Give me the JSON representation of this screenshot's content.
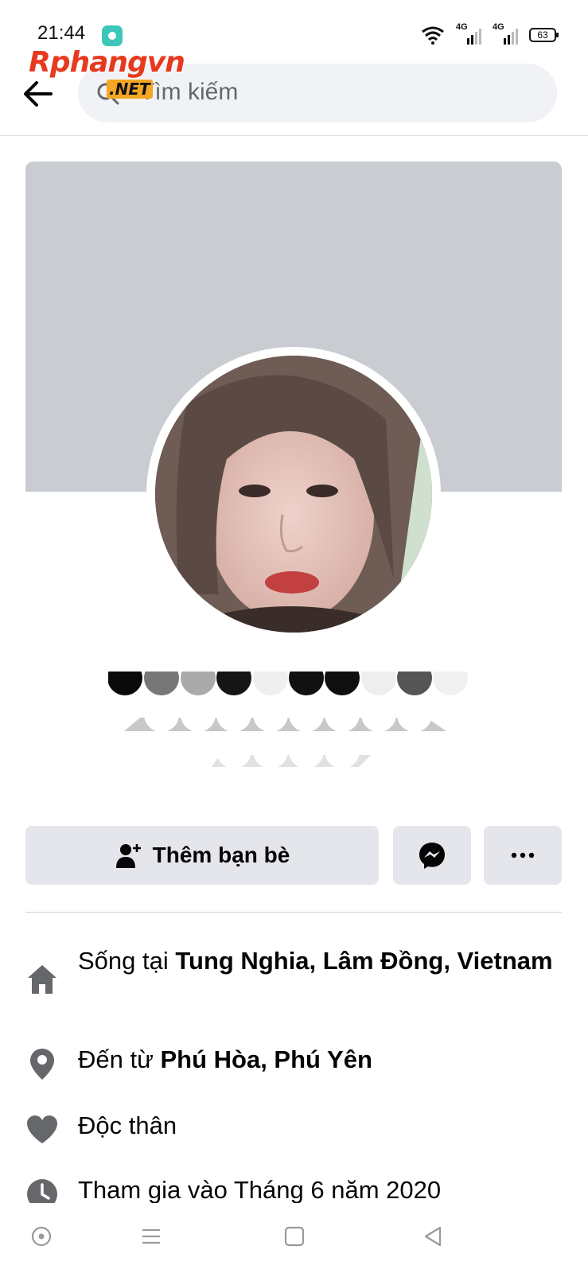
{
  "status_bar": {
    "time": "21:44",
    "network_1": "4G",
    "network_2": "4G",
    "battery": "63"
  },
  "watermark": {
    "brand": "Rphangvn",
    "suffix": ".NET"
  },
  "search": {
    "placeholder": "Tìm kiếm"
  },
  "profile": {
    "add_friend_label": "Thêm bạn bè"
  },
  "details": {
    "lives_in_prefix": "Sống tại ",
    "lives_in_value": "Tung Nghia, Lâm Đồng, Vietnam",
    "from_prefix": "Đến từ ",
    "from_value": "Phú Hòa, Phú Yên",
    "relationship": "Độc thân",
    "joined": "Tham gia vào Tháng 6 năm 2020"
  },
  "icons": {
    "back": "arrow-left-icon",
    "search": "search-icon",
    "add_friend": "person-add-icon",
    "messenger": "messenger-icon",
    "more": "more-dots-icon",
    "home": "home-icon",
    "location": "location-pin-icon",
    "heart": "heart-icon",
    "clock": "clock-icon"
  },
  "colors": {
    "cover": "#c9ccd1",
    "button_bg": "#e4e6eb",
    "icon_gray": "#65676b",
    "search_bg": "#f0f2f5"
  }
}
